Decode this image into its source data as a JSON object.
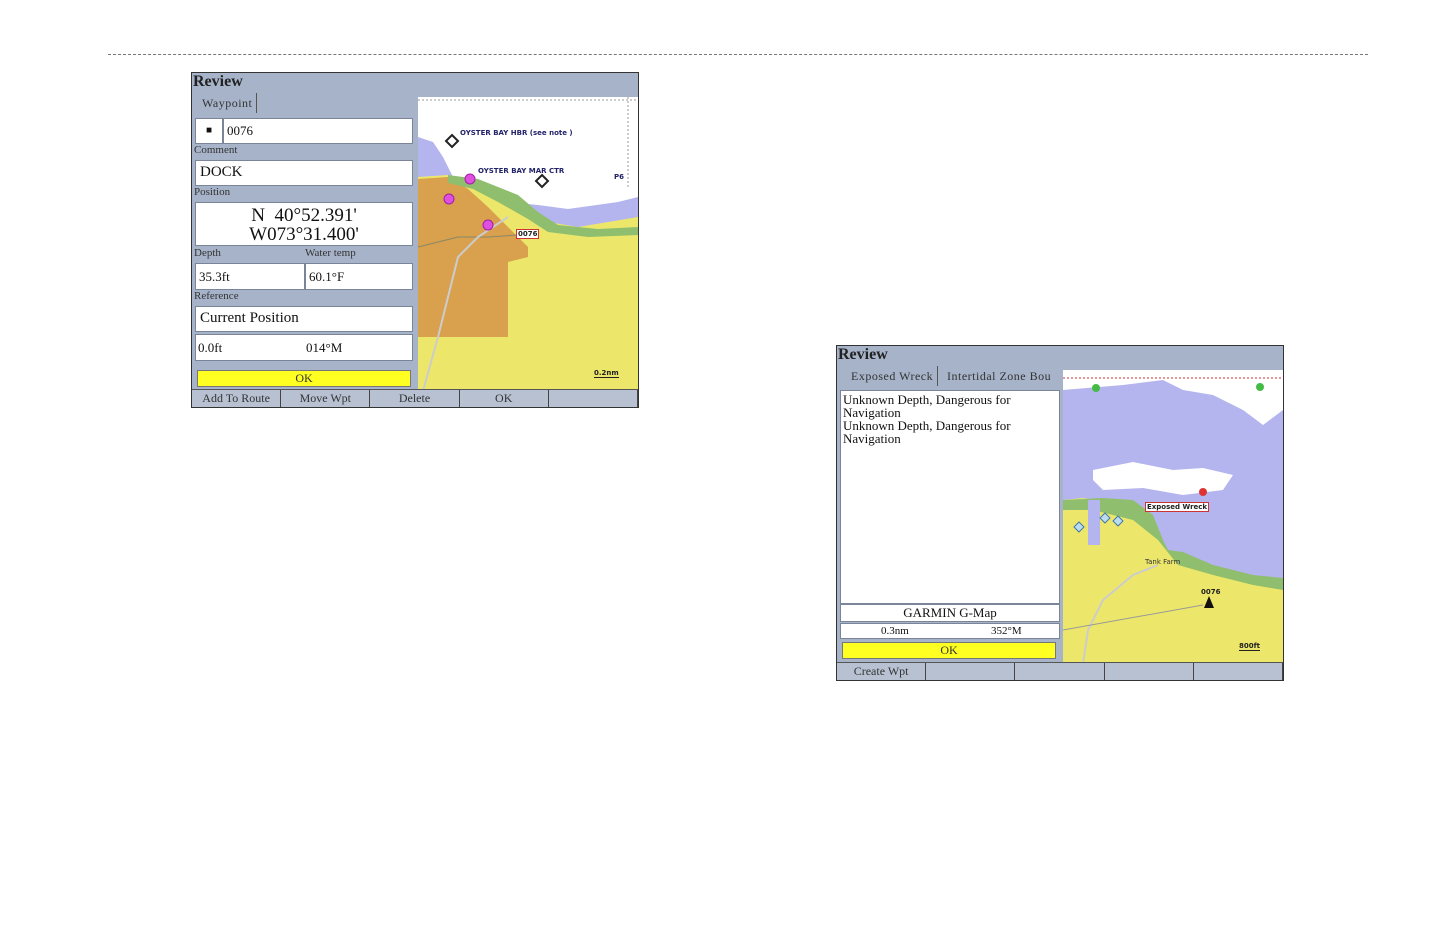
{
  "screen1": {
    "title": "Review",
    "tab": "Waypoint",
    "waypoint_icon": "square-icon",
    "waypoint_name": "0076",
    "comment_label": "Comment",
    "comment": "DOCK",
    "position_label": "Position",
    "lat": "N  40°52.391'",
    "lon": "W073°31.400'",
    "depth_label": "Depth",
    "depth": "35.3ft",
    "water_temp_label": "Water temp",
    "water_temp": "60.1°F",
    "reference_label": "Reference",
    "reference": "Current Position",
    "distance": "0.0ft",
    "bearing": "014°M",
    "ok": "OK",
    "map": {
      "labels": [
        "OYSTER BAY HBR (see note )",
        "OYSTER BAY MAR CTR",
        "P6",
        "0076"
      ],
      "scale": "0.2nm"
    },
    "softkeys": [
      "Add To Route",
      "Move Wpt",
      "Delete",
      "OK",
      ""
    ]
  },
  "screen2": {
    "title": "Review",
    "tabs": [
      "Exposed Wreck",
      "Intertidal Zone Bou"
    ],
    "description": [
      "Unknown Depth, Dangerous for Navigation",
      "Unknown Depth, Dangerous for Navigation"
    ],
    "source": "GARMIN G-Map",
    "distance": "0.3nm",
    "bearing": "352°M",
    "ok": "OK",
    "map": {
      "labels": [
        "Exposed Wreck",
        "Tank Farm",
        "0076"
      ],
      "scale": "800ft"
    },
    "softkeys": [
      "Create Wpt",
      "",
      "",
      "",
      ""
    ]
  },
  "colors": {
    "land_yellow": "#ece76a",
    "built_up": "#d9a04e",
    "water": "#b4b4ee",
    "intertidal": "#8fbf6e",
    "ok_button": "#ffff22",
    "frame": "#a6b3c9"
  }
}
